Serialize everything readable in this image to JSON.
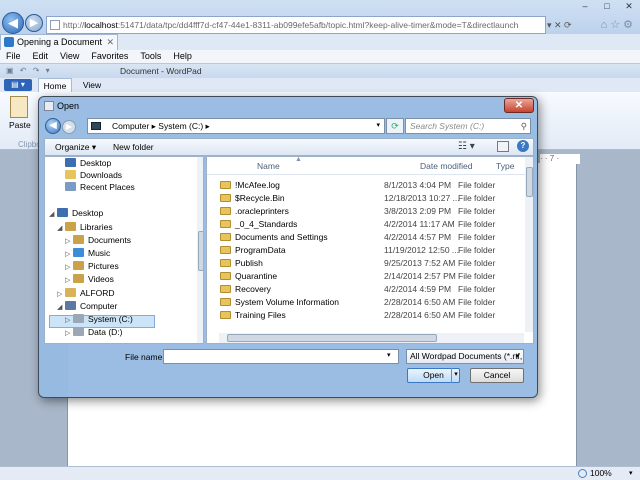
{
  "browser": {
    "address_prefix": "http://",
    "address_host": "localhost",
    "address_rest": ":51471/data/tpc/dd4fff7d-cf47-44e1-8311-ab099efe5afb/topic.html?keep-alive-timer&mode=T&directlaunch",
    "tab_label": "Opening a Document",
    "menu": [
      "File",
      "Edit",
      "View",
      "Favorites",
      "Tools",
      "Help"
    ],
    "zoom": "100%"
  },
  "wordpad": {
    "title": "Document - WordPad",
    "tabs": [
      "Home",
      "View"
    ],
    "paste_label": "Paste",
    "clipboard_group": "Clipbo",
    "ruler_text": "7"
  },
  "dialog": {
    "title": "Open",
    "path": "Computer  ▸  System (C:)  ▸",
    "search_placeholder": "Search System (C:)",
    "toolbar": {
      "organize": "Organize ▾",
      "new_folder": "New folder"
    },
    "nav_items": [
      {
        "label": "Desktop",
        "indent": 1,
        "twisty": "",
        "icon": "desktop"
      },
      {
        "label": "Downloads",
        "indent": 1,
        "twisty": "",
        "icon": "folder"
      },
      {
        "label": "Recent Places",
        "indent": 1,
        "twisty": "",
        "icon": "recent"
      },
      {
        "label": "Desktop",
        "indent": 0,
        "twisty": "◢",
        "icon": "desktop"
      },
      {
        "label": "Libraries",
        "indent": 1,
        "twisty": "◢",
        "icon": "library"
      },
      {
        "label": "Documents",
        "indent": 2,
        "twisty": "▷",
        "icon": "library"
      },
      {
        "label": "Music",
        "indent": 2,
        "twisty": "▷",
        "icon": "music"
      },
      {
        "label": "Pictures",
        "indent": 2,
        "twisty": "▷",
        "icon": "library"
      },
      {
        "label": "Videos",
        "indent": 2,
        "twisty": "▷",
        "icon": "library"
      },
      {
        "label": "ALFORD",
        "indent": 1,
        "twisty": "▷",
        "icon": "user"
      },
      {
        "label": "Computer",
        "indent": 1,
        "twisty": "◢",
        "icon": "computer"
      },
      {
        "label": "System (C:)",
        "indent": 2,
        "twisty": "▷",
        "icon": "drive"
      },
      {
        "label": "Data (D:)",
        "indent": 2,
        "twisty": "▷",
        "icon": "drive"
      }
    ],
    "columns": {
      "name": "Name",
      "date": "Date modified",
      "type": "Type"
    },
    "files": [
      {
        "name": "!McAfee.log",
        "date": "8/1/2013 4:04 PM",
        "type": "File folder"
      },
      {
        "name": "$Recycle.Bin",
        "date": "12/18/2013 10:27 ...",
        "type": "File folder"
      },
      {
        "name": ".oracleprinters",
        "date": "3/8/2013 2:09 PM",
        "type": "File folder"
      },
      {
        "name": "_0_4_Standards",
        "date": "4/2/2014 11:17 AM",
        "type": "File folder"
      },
      {
        "name": "Documents and Settings",
        "date": "4/2/2014 4:57 PM",
        "type": "File folder"
      },
      {
        "name": "ProgramData",
        "date": "11/19/2012 12:50 ...",
        "type": "File folder"
      },
      {
        "name": "Publish",
        "date": "9/25/2013 7:52 AM",
        "type": "File folder"
      },
      {
        "name": "Quarantine",
        "date": "2/14/2014 2:57 PM",
        "type": "File folder"
      },
      {
        "name": "Recovery",
        "date": "4/2/2014 4:59 PM",
        "type": "File folder"
      },
      {
        "name": "System Volume Information",
        "date": "2/28/2014 6:50 AM",
        "type": "File folder"
      },
      {
        "name": "Training Files",
        "date": "2/28/2014 6:50 AM",
        "type": "File folder"
      }
    ],
    "file_name_label": "File name:",
    "file_name_value": "",
    "file_type": "All Wordpad Documents (*.rtf, ...",
    "open_label": "Open",
    "cancel_label": "Cancel"
  },
  "colors": {
    "accent": "#3a78c4",
    "folder": "#e8c45c",
    "selection": "#cce4f7"
  }
}
